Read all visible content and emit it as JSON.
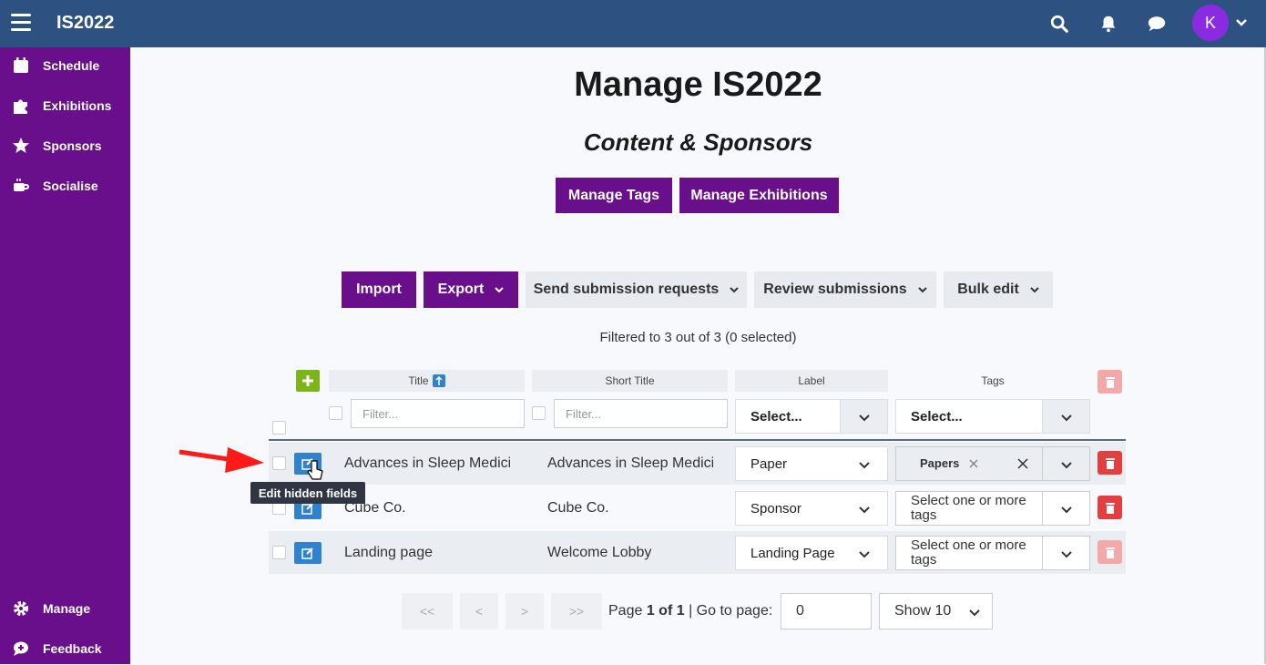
{
  "app": {
    "title": "IS2022",
    "avatar_initial": "K"
  },
  "topbar_icons": [
    "search-icon",
    "bell-icon",
    "chat-icon",
    "chevron-down-icon"
  ],
  "sidebar": {
    "items": [
      {
        "label": "Schedule",
        "icon": "calendar-icon"
      },
      {
        "label": "Exhibitions",
        "icon": "puzzle-icon"
      },
      {
        "label": "Sponsors",
        "icon": "star-icon"
      },
      {
        "label": "Socialise",
        "icon": "coffee-icon"
      }
    ],
    "bottom_items": [
      {
        "label": "Manage",
        "icon": "gear-icon"
      },
      {
        "label": "Feedback",
        "icon": "feedback-icon"
      }
    ]
  },
  "page": {
    "title": "Manage IS2022",
    "subtitle": "Content & Sponsors"
  },
  "actions": {
    "manage_tags": "Manage Tags",
    "manage_exhibitions": "Manage Exhibitions"
  },
  "toolbar": {
    "import": "Import",
    "export": "Export",
    "send_requests": "Send submission requests",
    "review": "Review submissions",
    "bulk_edit": "Bulk edit"
  },
  "filter_status": "Filtered to 3 out of 3 (0 selected)",
  "table": {
    "headers": {
      "title": "Title",
      "short_title": "Short Title",
      "label": "Label",
      "tags": "Tags"
    },
    "filters": {
      "title_placeholder": "Filter...",
      "short_title_placeholder": "Filter...",
      "label_select": "Select...",
      "tags_select": "Select..."
    },
    "rows": [
      {
        "title": "Advances in Sleep Medicine",
        "short_title": "Advances in Sleep Medicine",
        "label": "Paper",
        "tag_chip": "Papers",
        "tags_placeholder": ""
      },
      {
        "title": "Cube Co.",
        "short_title": "Cube Co.",
        "label": "Sponsor",
        "tag_chip": "",
        "tags_placeholder": "Select one or more tags"
      },
      {
        "title": "Landing page",
        "short_title": "Welcome Lobby",
        "label": "Landing Page",
        "tag_chip": "",
        "tags_placeholder": "Select one or more tags"
      }
    ]
  },
  "tooltip": "Edit hidden fields",
  "pagination": {
    "first": "<<",
    "prev": "<",
    "next": ">",
    "last": ">>",
    "page_prefix": "Page",
    "page_info": "1 of 1",
    "goto_label": "| Go to page:",
    "goto_value": "0",
    "show": "Show 10"
  },
  "colors": {
    "topbar": "#2d5282",
    "sidebar": "#690f8c",
    "primary": "#690f8c",
    "edit": "#3182ce",
    "delete": "#e53e3e",
    "add": "#7cb518"
  }
}
